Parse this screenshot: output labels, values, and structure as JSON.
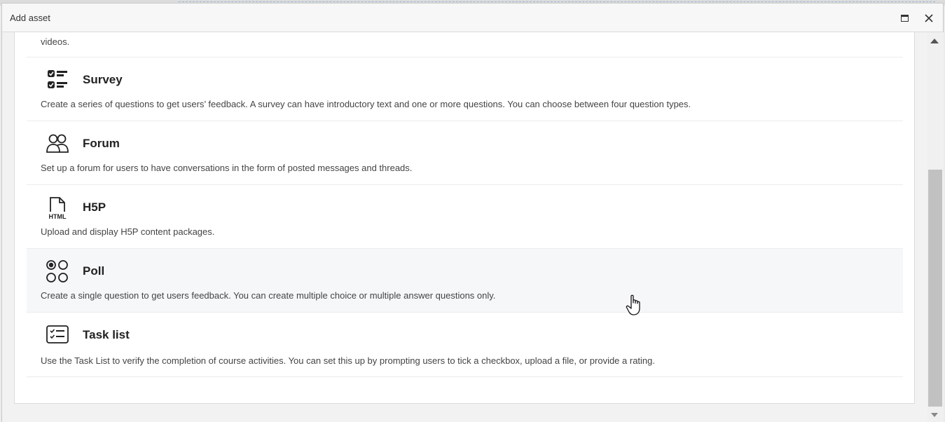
{
  "dialog": {
    "title": "Add asset"
  },
  "previous_item": {
    "desc_tail": "videos."
  },
  "assets": [
    {
      "name": "Survey",
      "icon": "survey-checklist-icon",
      "description": "Create a series of questions to get users’ feedback. A survey can have introductory text and one or more questions. You can choose between four question types."
    },
    {
      "name": "Forum",
      "icon": "forum-users-icon",
      "description": "Set up a forum for users to have conversations in the form of posted messages and threads."
    },
    {
      "name": "H5P",
      "icon": "html-file-icon",
      "icon_text": "HTML",
      "description": "Upload and display H5P content packages."
    },
    {
      "name": "Poll",
      "icon": "poll-options-icon",
      "description": "Create a single question to get users feedback. You can create multiple choice or multiple answer questions only."
    },
    {
      "name": "Task list",
      "icon": "task-list-icon",
      "description": "Use the Task List to verify the completion of course activities. You can set this up by prompting users to tick a checkbox, upload a file, or provide a rating."
    }
  ],
  "colors": {
    "highlight_row": "#f6f7f9",
    "separator": "#ececec",
    "text": "#444444"
  }
}
